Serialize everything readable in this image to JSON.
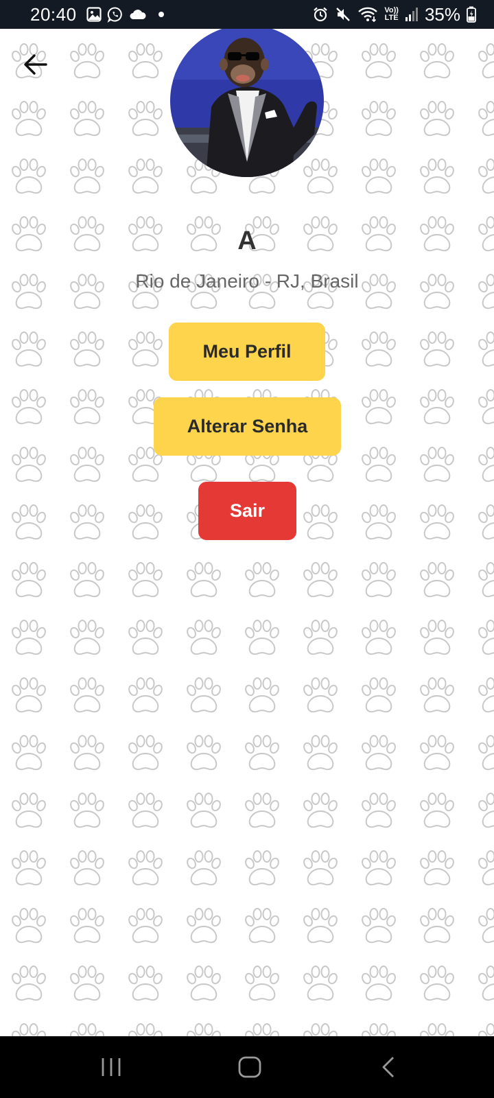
{
  "status_bar": {
    "time": "20:40",
    "battery_percent": "35%",
    "network_label_top": "Vo))",
    "network_label_bottom": "LTE",
    "left_icons": [
      "image-icon",
      "whatsapp-icon",
      "cloud-icon",
      "dot-icon"
    ],
    "right_icons": [
      "alarm-icon",
      "mute-icon",
      "wifi-icon",
      "volte-icon",
      "signal-icon",
      "battery-icon"
    ]
  },
  "profile": {
    "name": "A",
    "location": "Rio de Janeiro - RJ, Brasil"
  },
  "buttons": {
    "my_profile": "Meu Perfil",
    "change_password": "Alterar Senha",
    "logout": "Sair"
  },
  "colors": {
    "status_bar_bg": "#141a24",
    "primary_button": "#fdd44c",
    "danger_button": "#e53935",
    "pattern_stroke": "#c8c8c8"
  },
  "nav": {
    "items": [
      "recent-apps-icon",
      "home-icon",
      "back-nav-icon"
    ]
  }
}
